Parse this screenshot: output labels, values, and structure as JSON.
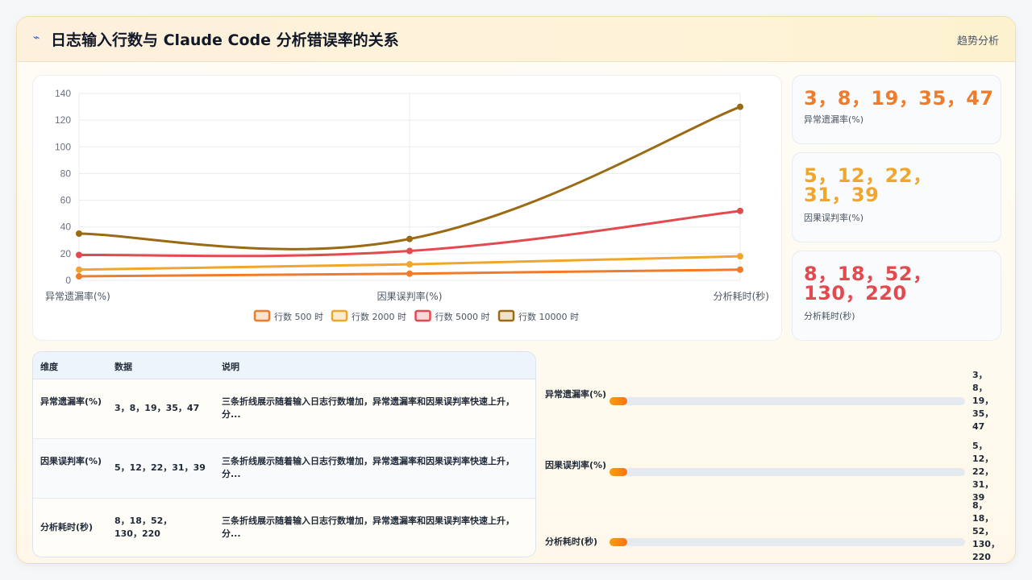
{
  "header": {
    "icon": "lightning-icon",
    "title": "日志输入行数与 Claude Code 分析错误率的关系",
    "tag": "趋势分析"
  },
  "chart_data": {
    "type": "line",
    "categories": [
      "异常遗漏率(%)",
      "因果误判率(%)",
      "分析耗时(秒)"
    ],
    "ylim": [
      0,
      140
    ],
    "yticks": [
      0,
      20,
      40,
      60,
      80,
      100,
      120,
      140
    ],
    "grid": true,
    "legend_position": "bottom",
    "series": [
      {
        "name": "行数 500 时",
        "values": [
          3,
          5,
          8
        ],
        "color": "#f07b2a",
        "fill": "#fde4cf"
      },
      {
        "name": "行数 2000 时",
        "values": [
          8,
          12,
          18
        ],
        "color": "#f2a52b",
        "fill": "#fdedcc"
      },
      {
        "name": "行数 5000 时",
        "values": [
          19,
          22,
          52
        ],
        "color": "#e34a4f",
        "fill": "#fbd7d8"
      },
      {
        "name": "行数 10000 时",
        "values": [
          35,
          31,
          130
        ],
        "color": "#9a6a14",
        "fill": "#efe3c9"
      }
    ]
  },
  "stats": [
    {
      "value": "3，8，19，35，47",
      "label": "异常遗漏率(%)",
      "color": "#f07b2a"
    },
    {
      "value": "5，12，22，31，39",
      "label": "因果误判率(%)",
      "color": "#f2a52b"
    },
    {
      "value": "8，18，52，130，220",
      "label": "分析耗时(秒)",
      "color": "#e34a4f"
    }
  ],
  "table": {
    "headers": [
      "维度",
      "数据",
      "说明"
    ],
    "rows": [
      {
        "dim": "异常遗漏率(%)",
        "data": "3，8，19，35，47",
        "desc": "三条折线展示随着输入日志行数增加，异常遗漏率和因果误判率快速上升，分..."
      },
      {
        "dim": "因果误判率(%)",
        "data": "5，12，22，31，39",
        "desc": "三条折线展示随着输入日志行数增加，异常遗漏率和因果误判率快速上升，分..."
      },
      {
        "dim": "分析耗时(秒)",
        "data": "8，18，52，130，220",
        "desc": "三条折线展示随着输入日志行数增加，异常遗漏率和因果误判率快速上升，分..."
      }
    ]
  },
  "bars": [
    {
      "label": "异常遗漏率(%)",
      "value": "3，8，19，35，47",
      "fraction": 0.05
    },
    {
      "label": "因果误判率(%)",
      "value": "5，12，22，31，39",
      "fraction": 0.05
    },
    {
      "label": "分析耗时(秒)",
      "value": "8，18，52，130，220",
      "fraction": 0.05
    }
  ]
}
